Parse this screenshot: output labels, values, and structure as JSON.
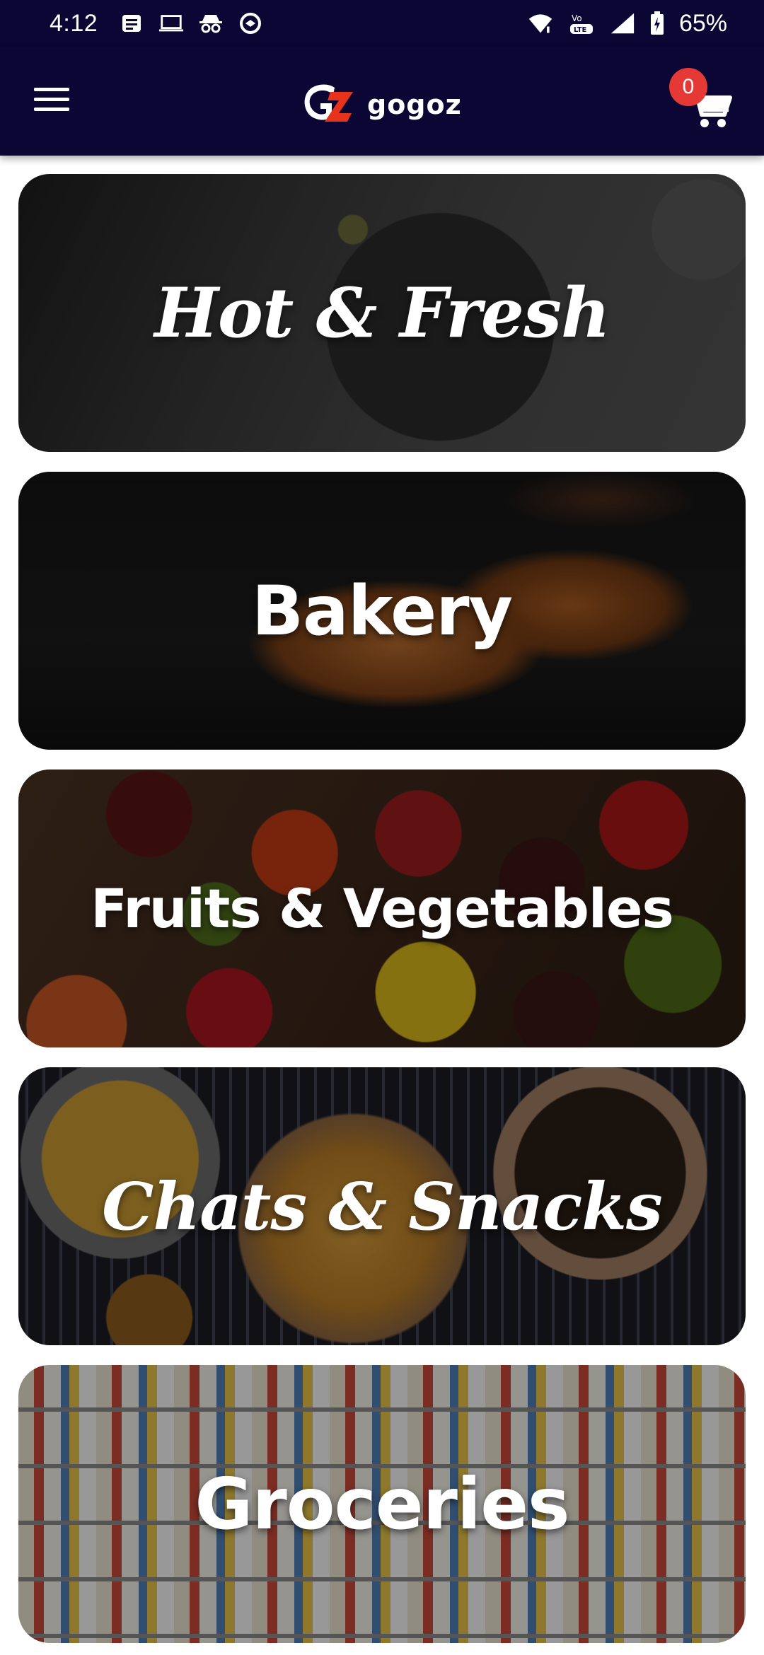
{
  "status_bar": {
    "time": "4:12",
    "network_label": "Vo LTE",
    "battery_percent": "65%",
    "left_icons": [
      "message-icon",
      "laptop-icon",
      "incognito-icon",
      "data-saver-icon"
    ],
    "right_icons": [
      "wifi-icon",
      "volte-icon",
      "signal-icon",
      "battery-icon"
    ]
  },
  "app_bar": {
    "menu_icon": "hamburger-menu-icon",
    "logo_text": "gogoz",
    "cart_icon": "shopping-cart-icon",
    "cart_count": "0"
  },
  "categories": [
    {
      "label": "Hot & Fresh"
    },
    {
      "label": "Bakery"
    },
    {
      "label": "Fruits & Vegetables"
    },
    {
      "label": "Chats & Snacks"
    },
    {
      "label": "Groceries"
    }
  ],
  "colors": {
    "header_bg": "#0b0633",
    "badge_bg": "#e53935",
    "logo_red": "#e8331c",
    "text": "#ffffff"
  }
}
